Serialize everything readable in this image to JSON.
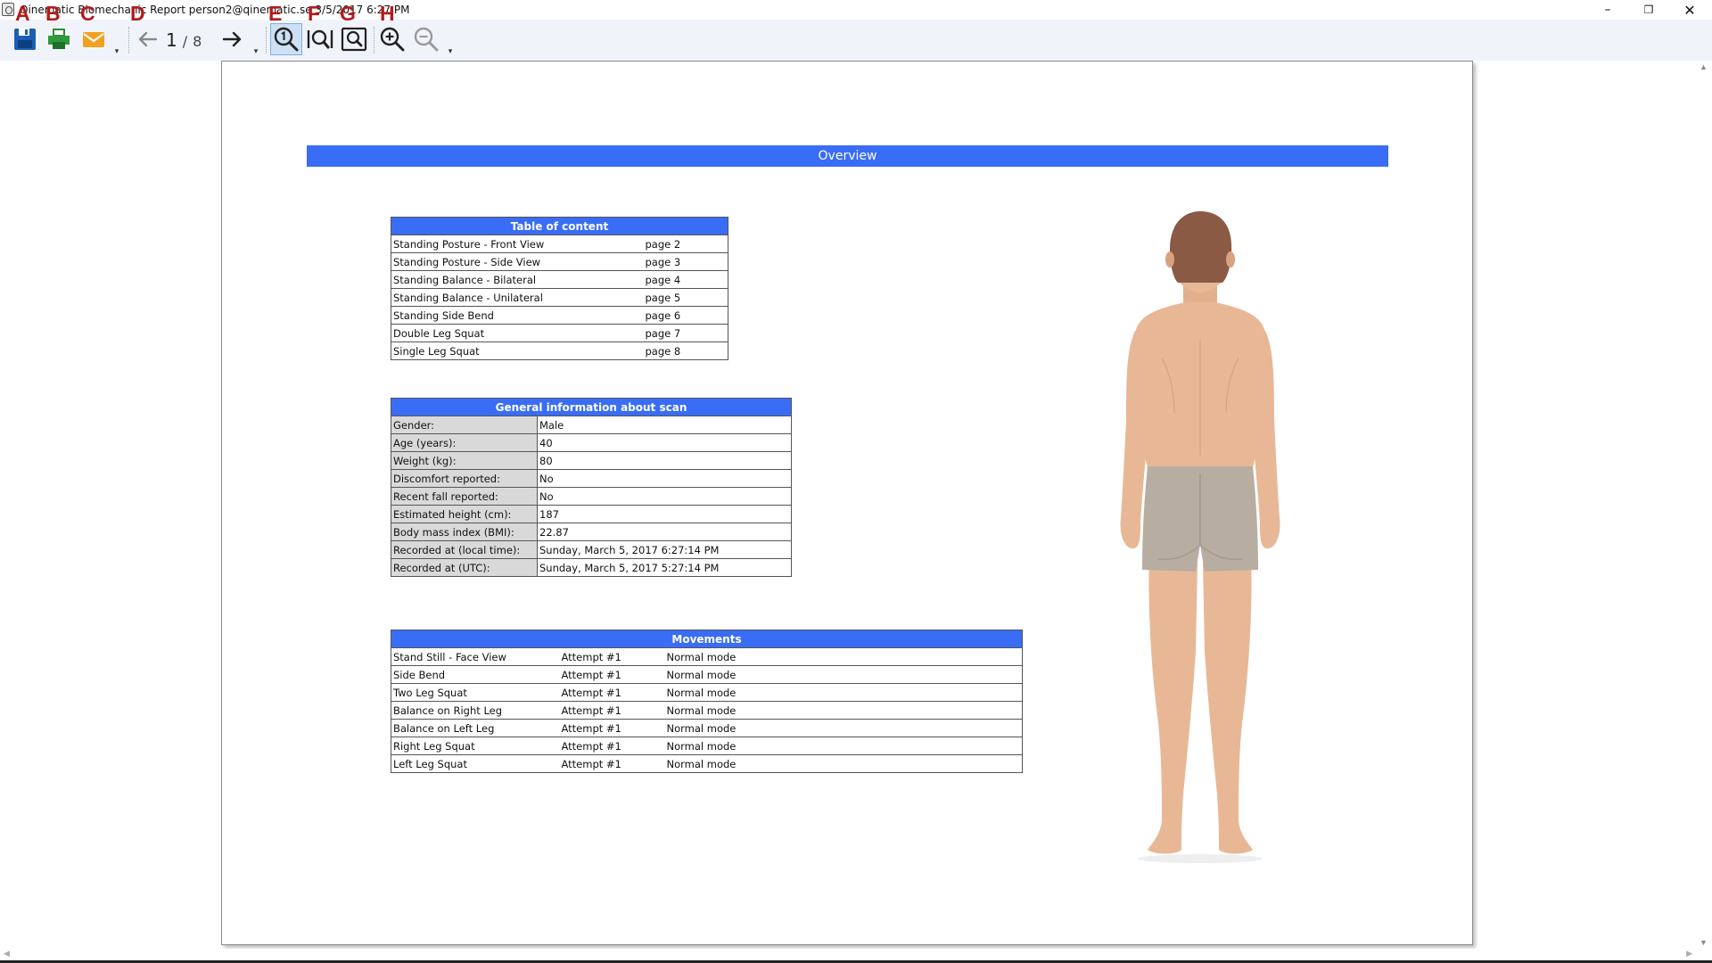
{
  "window": {
    "title": "Qinematic Biomechanic Report person2@qinematic.se 3/5/2017 6:27 PM",
    "minimize": "–",
    "restore": "❐",
    "close": "✕"
  },
  "toolbar": {
    "page_current": "1",
    "page_separator": "/",
    "page_total": "8",
    "more_glyph": "▾",
    "annotations": [
      "A",
      "B",
      "C",
      "D",
      "E",
      "F",
      "G",
      "H"
    ],
    "icons": {
      "save": "save-icon",
      "print": "print-icon",
      "email": "email-icon",
      "previous": "arrow-left-icon",
      "next": "arrow-right-icon",
      "actual_size": "zoom-actual-size-icon",
      "fit_width": "fit-width-icon",
      "fit_page": "fit-page-icon",
      "zoom_in": "zoom-in-icon",
      "zoom_out": "zoom-out-icon"
    }
  },
  "report": {
    "banner": "Overview",
    "toc": {
      "header": "Table of content",
      "rows": [
        {
          "name": "Standing Posture - Front View",
          "page": "page 2"
        },
        {
          "name": "Standing Posture - Side View",
          "page": "page 3"
        },
        {
          "name": "Standing Balance - Bilateral",
          "page": "page 4"
        },
        {
          "name": "Standing Balance - Unilateral",
          "page": "page 5"
        },
        {
          "name": "Standing Side Bend",
          "page": "page 6"
        },
        {
          "name": "Double Leg Squat",
          "page": "page 7"
        },
        {
          "name": "Single Leg Squat",
          "page": "page 8"
        }
      ]
    },
    "general": {
      "header": "General information about scan",
      "rows": [
        {
          "label": "Gender:",
          "value": "Male"
        },
        {
          "label": "Age (years):",
          "value": "40"
        },
        {
          "label": "Weight (kg):",
          "value": "80"
        },
        {
          "label": "Discomfort reported:",
          "value": "No"
        },
        {
          "label": "Recent fall reported:",
          "value": "No"
        },
        {
          "label": "Estimated height (cm):",
          "value": "187"
        },
        {
          "label": "Body mass index (BMI):",
          "value": "22.87"
        },
        {
          "label": "Recorded at (local time):",
          "value": "Sunday, March 5, 2017 6:27:14 PM"
        },
        {
          "label": "Recorded at (UTC):",
          "value": "Sunday, March 5, 2017 5:27:14 PM"
        }
      ]
    },
    "movements": {
      "header": "Movements",
      "rows": [
        {
          "name": "Stand Still - Face View",
          "attempt": "Attempt #1",
          "mode": "Normal mode"
        },
        {
          "name": "Side Bend",
          "attempt": "Attempt #1",
          "mode": "Normal mode"
        },
        {
          "name": "Two Leg Squat",
          "attempt": "Attempt #1",
          "mode": "Normal mode"
        },
        {
          "name": "Balance on Right Leg",
          "attempt": "Attempt #1",
          "mode": "Normal mode"
        },
        {
          "name": "Balance on Left Leg",
          "attempt": "Attempt #1",
          "mode": "Normal mode"
        },
        {
          "name": "Right Leg Squat",
          "attempt": "Attempt #1",
          "mode": "Normal mode"
        },
        {
          "name": "Left Leg Squat",
          "attempt": "Attempt #1",
          "mode": "Normal mode"
        }
      ]
    },
    "figure": "body-back-view"
  },
  "colors": {
    "accent": "#3a6df5",
    "label_bg": "#d9d9d9",
    "annotation": "#b31a1a",
    "toolbar_bg": "#f0f4fa",
    "skin": "#e8b896",
    "hair": "#8b5a45",
    "shorts": "#b8ada1"
  }
}
